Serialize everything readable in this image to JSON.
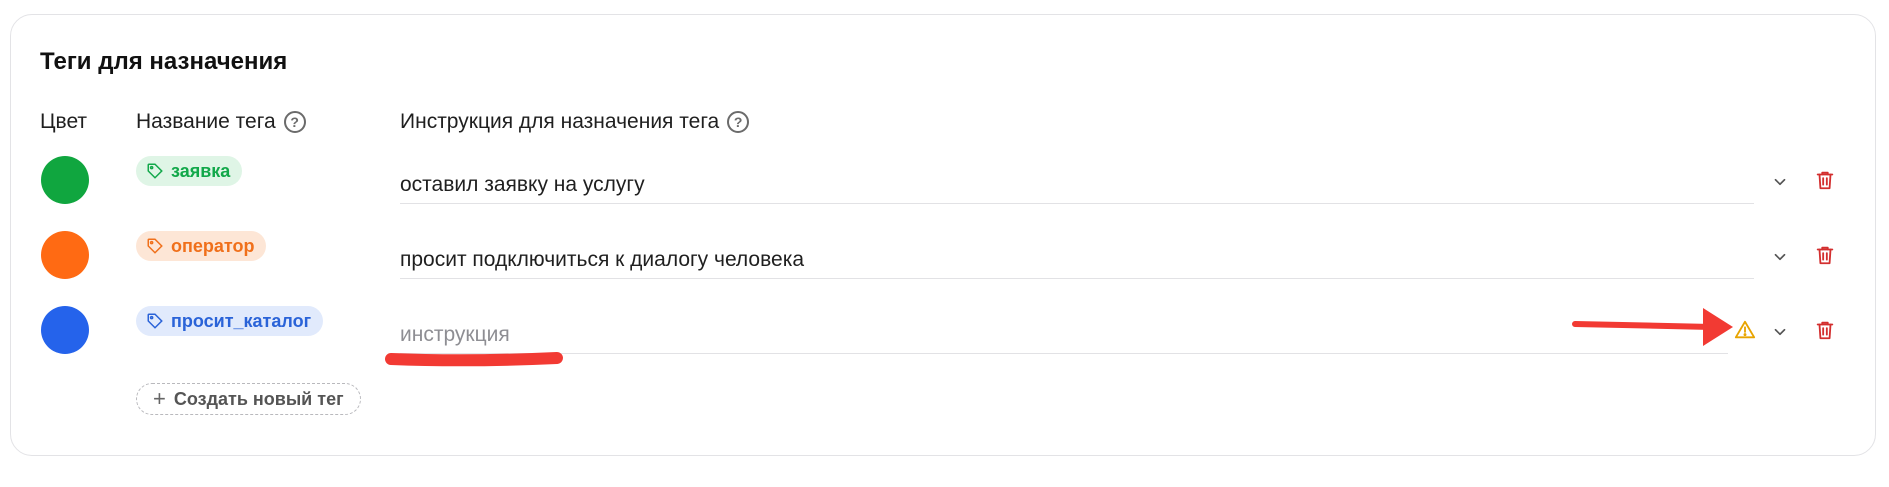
{
  "section": {
    "title": "Теги для назначения"
  },
  "columns": {
    "color": "Цвет",
    "tag_name": "Название тега",
    "instruction": "Инструкция для назначения тега"
  },
  "rows": [
    {
      "color": "#10a63f",
      "tag": "заявка",
      "tag_text_color": "#12a84a",
      "tag_bg": "#dff5e6",
      "instruction": "оставил заявку на услугу",
      "placeholder": false
    },
    {
      "color": "#ff6a13",
      "tag": "оператор",
      "tag_text_color": "#f0701b",
      "tag_bg": "#fde6d6",
      "instruction": "просит подключиться к диалогу человека",
      "placeholder": false
    },
    {
      "color": "#2563eb",
      "tag": "просит_каталог",
      "tag_text_color": "#2a63d8",
      "tag_bg": "#e1eafc",
      "instruction": "инструкция",
      "placeholder": true,
      "warning": true
    }
  ],
  "create_button": {
    "label": "Создать новый тег"
  },
  "icons": {
    "help": "question-circle-icon",
    "tag": "tag-icon",
    "chevron": "chevron-down-icon",
    "trash": "trash-icon",
    "warning": "warning-triangle-icon",
    "plus": "plus-icon"
  },
  "colors": {
    "delete_red": "#d32f2f",
    "warning_amber": "#e8a400",
    "annotation_red": "#f23a33"
  }
}
